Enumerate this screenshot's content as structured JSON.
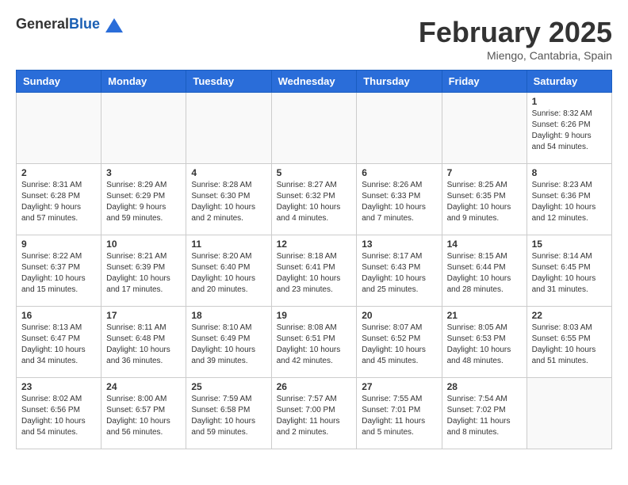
{
  "header": {
    "logo_general": "General",
    "logo_blue": "Blue",
    "month_title": "February 2025",
    "location": "Miengo, Cantabria, Spain"
  },
  "weekdays": [
    "Sunday",
    "Monday",
    "Tuesday",
    "Wednesday",
    "Thursday",
    "Friday",
    "Saturday"
  ],
  "weeks": [
    [
      {
        "day": "",
        "info": ""
      },
      {
        "day": "",
        "info": ""
      },
      {
        "day": "",
        "info": ""
      },
      {
        "day": "",
        "info": ""
      },
      {
        "day": "",
        "info": ""
      },
      {
        "day": "",
        "info": ""
      },
      {
        "day": "1",
        "info": "Sunrise: 8:32 AM\nSunset: 6:26 PM\nDaylight: 9 hours\nand 54 minutes."
      }
    ],
    [
      {
        "day": "2",
        "info": "Sunrise: 8:31 AM\nSunset: 6:28 PM\nDaylight: 9 hours\nand 57 minutes."
      },
      {
        "day": "3",
        "info": "Sunrise: 8:29 AM\nSunset: 6:29 PM\nDaylight: 9 hours\nand 59 minutes."
      },
      {
        "day": "4",
        "info": "Sunrise: 8:28 AM\nSunset: 6:30 PM\nDaylight: 10 hours\nand 2 minutes."
      },
      {
        "day": "5",
        "info": "Sunrise: 8:27 AM\nSunset: 6:32 PM\nDaylight: 10 hours\nand 4 minutes."
      },
      {
        "day": "6",
        "info": "Sunrise: 8:26 AM\nSunset: 6:33 PM\nDaylight: 10 hours\nand 7 minutes."
      },
      {
        "day": "7",
        "info": "Sunrise: 8:25 AM\nSunset: 6:35 PM\nDaylight: 10 hours\nand 9 minutes."
      },
      {
        "day": "8",
        "info": "Sunrise: 8:23 AM\nSunset: 6:36 PM\nDaylight: 10 hours\nand 12 minutes."
      }
    ],
    [
      {
        "day": "9",
        "info": "Sunrise: 8:22 AM\nSunset: 6:37 PM\nDaylight: 10 hours\nand 15 minutes."
      },
      {
        "day": "10",
        "info": "Sunrise: 8:21 AM\nSunset: 6:39 PM\nDaylight: 10 hours\nand 17 minutes."
      },
      {
        "day": "11",
        "info": "Sunrise: 8:20 AM\nSunset: 6:40 PM\nDaylight: 10 hours\nand 20 minutes."
      },
      {
        "day": "12",
        "info": "Sunrise: 8:18 AM\nSunset: 6:41 PM\nDaylight: 10 hours\nand 23 minutes."
      },
      {
        "day": "13",
        "info": "Sunrise: 8:17 AM\nSunset: 6:43 PM\nDaylight: 10 hours\nand 25 minutes."
      },
      {
        "day": "14",
        "info": "Sunrise: 8:15 AM\nSunset: 6:44 PM\nDaylight: 10 hours\nand 28 minutes."
      },
      {
        "day": "15",
        "info": "Sunrise: 8:14 AM\nSunset: 6:45 PM\nDaylight: 10 hours\nand 31 minutes."
      }
    ],
    [
      {
        "day": "16",
        "info": "Sunrise: 8:13 AM\nSunset: 6:47 PM\nDaylight: 10 hours\nand 34 minutes."
      },
      {
        "day": "17",
        "info": "Sunrise: 8:11 AM\nSunset: 6:48 PM\nDaylight: 10 hours\nand 36 minutes."
      },
      {
        "day": "18",
        "info": "Sunrise: 8:10 AM\nSunset: 6:49 PM\nDaylight: 10 hours\nand 39 minutes."
      },
      {
        "day": "19",
        "info": "Sunrise: 8:08 AM\nSunset: 6:51 PM\nDaylight: 10 hours\nand 42 minutes."
      },
      {
        "day": "20",
        "info": "Sunrise: 8:07 AM\nSunset: 6:52 PM\nDaylight: 10 hours\nand 45 minutes."
      },
      {
        "day": "21",
        "info": "Sunrise: 8:05 AM\nSunset: 6:53 PM\nDaylight: 10 hours\nand 48 minutes."
      },
      {
        "day": "22",
        "info": "Sunrise: 8:03 AM\nSunset: 6:55 PM\nDaylight: 10 hours\nand 51 minutes."
      }
    ],
    [
      {
        "day": "23",
        "info": "Sunrise: 8:02 AM\nSunset: 6:56 PM\nDaylight: 10 hours\nand 54 minutes."
      },
      {
        "day": "24",
        "info": "Sunrise: 8:00 AM\nSunset: 6:57 PM\nDaylight: 10 hours\nand 56 minutes."
      },
      {
        "day": "25",
        "info": "Sunrise: 7:59 AM\nSunset: 6:58 PM\nDaylight: 10 hours\nand 59 minutes."
      },
      {
        "day": "26",
        "info": "Sunrise: 7:57 AM\nSunset: 7:00 PM\nDaylight: 11 hours\nand 2 minutes."
      },
      {
        "day": "27",
        "info": "Sunrise: 7:55 AM\nSunset: 7:01 PM\nDaylight: 11 hours\nand 5 minutes."
      },
      {
        "day": "28",
        "info": "Sunrise: 7:54 AM\nSunset: 7:02 PM\nDaylight: 11 hours\nand 8 minutes."
      },
      {
        "day": "",
        "info": ""
      }
    ]
  ]
}
